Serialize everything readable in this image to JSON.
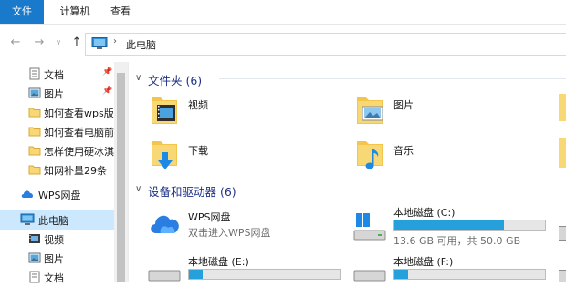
{
  "ribbon": {
    "tabs": [
      {
        "label": "文件",
        "active": true
      },
      {
        "label": "计算机",
        "active": false
      },
      {
        "label": "查看",
        "active": false
      }
    ]
  },
  "nav": {
    "back_icon": "back-arrow-icon",
    "forward_icon": "forward-arrow-icon",
    "recent_icon": "chevron-down-icon",
    "up_icon": "up-arrow-icon",
    "address": {
      "location_icon": "this-pc-icon",
      "separator": "›",
      "path": "此电脑"
    }
  },
  "sidebar": {
    "items": [
      {
        "label": "文档",
        "icon": "documents-icon",
        "pinned": true
      },
      {
        "label": "图片",
        "icon": "pictures-icon",
        "pinned": true
      },
      {
        "label": "如何查看wps版本",
        "icon": "folder-icon",
        "pinned": false
      },
      {
        "label": "如何查看电脑前缀",
        "icon": "folder-icon",
        "pinned": false
      },
      {
        "label": "怎样使用硬冰淇淋",
        "icon": "folder-icon",
        "pinned": false
      },
      {
        "label": "知网补量29条",
        "icon": "folder-icon",
        "pinned": false
      },
      {
        "label": "WPS网盘",
        "icon": "cloud-icon",
        "pinned": false
      },
      {
        "label": "此电脑",
        "icon": "this-pc-icon",
        "pinned": false,
        "selected": true
      },
      {
        "label": "视频",
        "icon": "videos-icon",
        "pinned": false
      },
      {
        "label": "图片",
        "icon": "pictures-icon",
        "pinned": false
      },
      {
        "label": "文档",
        "icon": "documents-icon",
        "pinned": false
      }
    ]
  },
  "main": {
    "folders_group": {
      "title": "文件夹 (6)",
      "items": [
        {
          "label": "视频",
          "icon": "videos-folder-icon"
        },
        {
          "label": "图片",
          "icon": "pictures-folder-icon"
        },
        {
          "label": "下载",
          "icon": "downloads-folder-icon"
        },
        {
          "label": "音乐",
          "icon": "music-folder-icon"
        }
      ]
    },
    "drives_group": {
      "title": "设备和驱动器 (6)",
      "items": [
        {
          "name": "WPS网盘",
          "subtitle": "双击进入WPS网盘",
          "icon": "wps-cloud-drive-icon"
        },
        {
          "name": "本地磁盘 (C:)",
          "subtitle": "13.6 GB 可用，共 50.0 GB",
          "icon": "windows-drive-icon",
          "used_fraction": 0.73
        },
        {
          "name": "本地磁盘 (E:)",
          "icon": "local-drive-icon",
          "used_fraction": 0.09
        },
        {
          "name": "本地磁盘 (F:)",
          "icon": "local-drive-icon",
          "used_fraction": 0.09
        }
      ]
    }
  },
  "colors": {
    "accent": "#1979ca",
    "selection": "#cce8ff",
    "group_header": "#1e3287",
    "drive_bar": "#26a0da"
  }
}
